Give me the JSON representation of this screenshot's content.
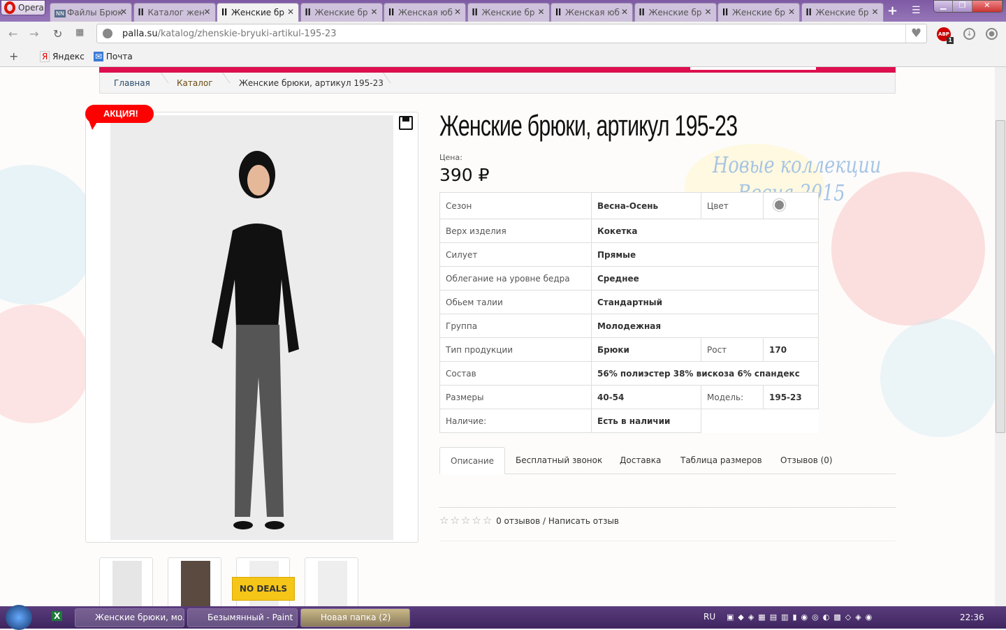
{
  "browser": {
    "menu_label": "Opera",
    "tabs": [
      {
        "label": "Файлы Брюк",
        "icon": "nn"
      },
      {
        "label": "Каталог жен",
        "icon": "palla"
      },
      {
        "label": "Женские бр",
        "icon": "palla",
        "active": true
      },
      {
        "label": "Женские бр",
        "icon": "palla"
      },
      {
        "label": "Женская юб",
        "icon": "palla"
      },
      {
        "label": "Женские бр",
        "icon": "palla"
      },
      {
        "label": "Женская юб",
        "icon": "palla"
      },
      {
        "label": "Женские бр",
        "icon": "palla"
      },
      {
        "label": "Женские бр",
        "icon": "palla"
      },
      {
        "label": "Женские бр",
        "icon": "palla"
      }
    ],
    "url_domain": "palla.su",
    "url_path": "/katalog/zhenskie-bryuki-artikul-195-23",
    "abp_badge": "ABP",
    "abp_count": "1",
    "bookmarks": [
      "Яндекс",
      "Почта"
    ]
  },
  "breadcrumb": [
    "Главная",
    "Каталог",
    "Женские брюки, артикул 195-23"
  ],
  "promo_badge": "АКЦИЯ!",
  "no_deals": "NO DEALS",
  "product": {
    "title": "Женские брюки, артикул 195-23",
    "price_label": "Цена:",
    "price": "390 ₽",
    "banner": [
      "Новые коллекции",
      "Весна 2015"
    ],
    "specs": [
      {
        "k": "Сезон",
        "v": "Весна-Осень",
        "k2": "Цвет",
        "v2": "",
        "color": "#888888"
      },
      {
        "k": "Верх изделия",
        "v": "Кокетка"
      },
      {
        "k": "Силует",
        "v": "Прямые"
      },
      {
        "k": "Облегание на уровне бедра",
        "v": "Среднее"
      },
      {
        "k": "Обьем талии",
        "v": "Стандартный"
      },
      {
        "k": "Группа",
        "v": "Молодежная"
      },
      {
        "k": "Тип продукции",
        "v": "Брюки",
        "k2": "Рост",
        "v2": "170"
      },
      {
        "k": "Состав",
        "v": "56% полиэстер 38% вискоза 6% спандекс"
      },
      {
        "k": "Размеры",
        "v": "40-54",
        "k2": "Модель:",
        "v2": "195-23"
      },
      {
        "k": "Наличие:",
        "v": "Есть в наличии"
      }
    ],
    "tabs": [
      "Описание",
      "Бесплатный звонок",
      "Доставка",
      "Таблица размеров",
      "Отзывов (0)"
    ],
    "reviews_count": "0 отзывов",
    "write_review": "Написать отзыв"
  },
  "taskbar": {
    "items": [
      "Женские брюки, мо...",
      "Безымянный - Paint",
      "Новая папка (2)"
    ],
    "lang": "RU",
    "time": "22:36"
  },
  "colors": {
    "accent": "#dd0f4f",
    "promo": "#ff0000"
  }
}
